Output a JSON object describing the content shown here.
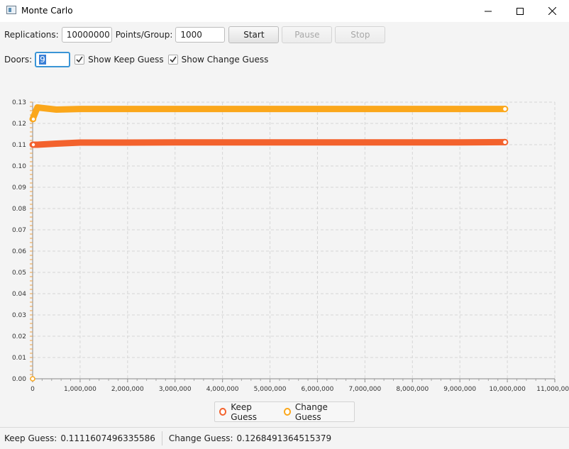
{
  "window": {
    "title": "Monte Carlo"
  },
  "controls": {
    "replications_label": "Replications:",
    "replications_value": "10000000",
    "points_group_label": "Points/Group:",
    "points_group_value": "1000",
    "start_label": "Start",
    "pause_label": "Pause",
    "stop_label": "Stop",
    "doors_label": "Doors:",
    "doors_value": "9",
    "show_keep_label": "Show Keep Guess",
    "show_keep_checked": true,
    "show_change_label": "Show Change Guess",
    "show_change_checked": true
  },
  "chart_data": {
    "type": "line",
    "xlim": [
      0,
      11000000
    ],
    "ylim": [
      0,
      0.13
    ],
    "x_ticks": [
      "0",
      "1,000,000",
      "2,000,000",
      "3,000,000",
      "4,000,000",
      "5,000,000",
      "6,000,000",
      "7,000,000",
      "8,000,000",
      "9,000,000",
      "10,000,000",
      "11,000,000"
    ],
    "y_ticks": [
      "0.00",
      "0.01",
      "0.02",
      "0.03",
      "0.04",
      "0.05",
      "0.06",
      "0.07",
      "0.08",
      "0.09",
      "0.10",
      "0.11",
      "0.12",
      "0.13"
    ],
    "grid": true,
    "series": [
      {
        "name": "Keep Guess",
        "color": "#f3622d",
        "x": [
          0,
          100000,
          500000,
          1000000,
          2000000,
          3000000,
          4000000,
          5000000,
          6000000,
          7000000,
          8000000,
          9000000,
          9950000
        ],
        "values": [
          0.11,
          0.11,
          0.1105,
          0.111,
          0.111,
          0.1111,
          0.1111,
          0.1111,
          0.1111,
          0.1111,
          0.1111,
          0.1111,
          0.1112
        ]
      },
      {
        "name": "Change Guess",
        "color": "#fba71b",
        "x": [
          0,
          100000,
          500000,
          1000000,
          2000000,
          3000000,
          4000000,
          5000000,
          6000000,
          7000000,
          8000000,
          9000000,
          9950000
        ],
        "values": [
          0.122,
          0.1275,
          0.1265,
          0.1268,
          0.1268,
          0.1268,
          0.1268,
          0.1268,
          0.1268,
          0.1268,
          0.1268,
          0.1268,
          0.1268
        ]
      }
    ]
  },
  "legend": {
    "keep_label": "Keep Guess",
    "change_label": "Change Guess"
  },
  "status": {
    "keep_label": "Keep Guess:",
    "keep_value": "0.1111607496335586",
    "change_label": "Change Guess:",
    "change_value": "0.1268491364515379"
  }
}
